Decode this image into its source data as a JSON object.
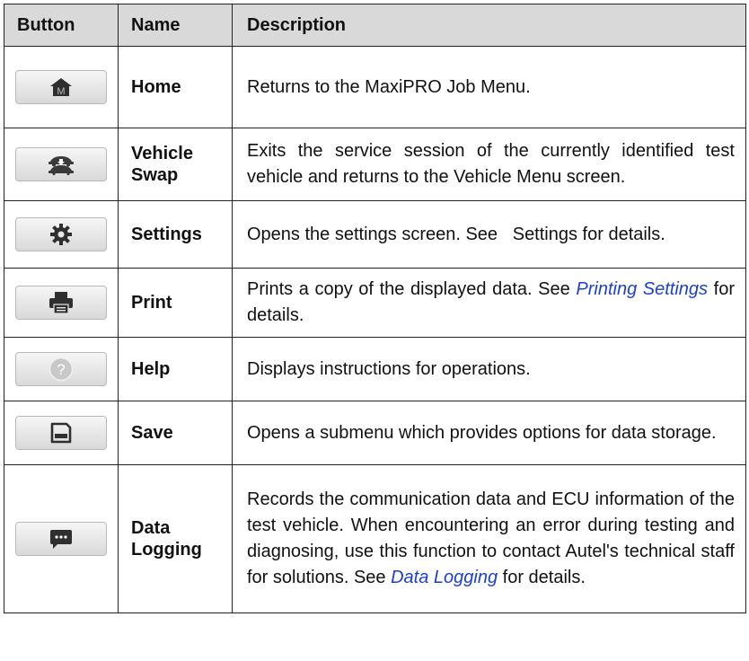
{
  "table": {
    "headers": {
      "button": "Button",
      "name": "Name",
      "description": "Description"
    },
    "rows": [
      {
        "icon": "home-icon",
        "name": "Home",
        "desc_text": "Returns to the MaxiPRO Job Menu."
      },
      {
        "icon": "vehicle-swap-icon",
        "name_line1": "Vehicle",
        "name_line2": "Swap",
        "desc_text": "Exits the service session of the currently identified test vehicle and returns to the Vehicle Menu screen."
      },
      {
        "icon": "gear-icon",
        "name": "Settings",
        "desc_text": "Opens the settings screen. See   Settings for details."
      },
      {
        "icon": "printer-icon",
        "name": "Print",
        "desc_pre": "Prints a copy of the displayed data. See ",
        "desc_link": "Printing Settings",
        "desc_post": " for details."
      },
      {
        "icon": "help-icon",
        "name": "Help",
        "desc_text": "Displays instructions for operations."
      },
      {
        "icon": "save-icon",
        "name": "Save",
        "desc_text": "Opens a submenu which provides options for data storage."
      },
      {
        "icon": "data-logging-icon",
        "name_line1": "Data",
        "name_line2": "Logging",
        "desc_pre": "Records the communication data and ECU information of the test vehicle. When encountering an error during testing and diagnosing, use this function to contact Autel's technical staff for solutions. See ",
        "desc_link": "Data Logging",
        "desc_post": " for details."
      }
    ]
  },
  "colors": {
    "header_bg": "#d9d9d9",
    "link": "#1a3fd9",
    "home_letter": "#8a8a8a",
    "help_icon": "#b8b8b8"
  }
}
